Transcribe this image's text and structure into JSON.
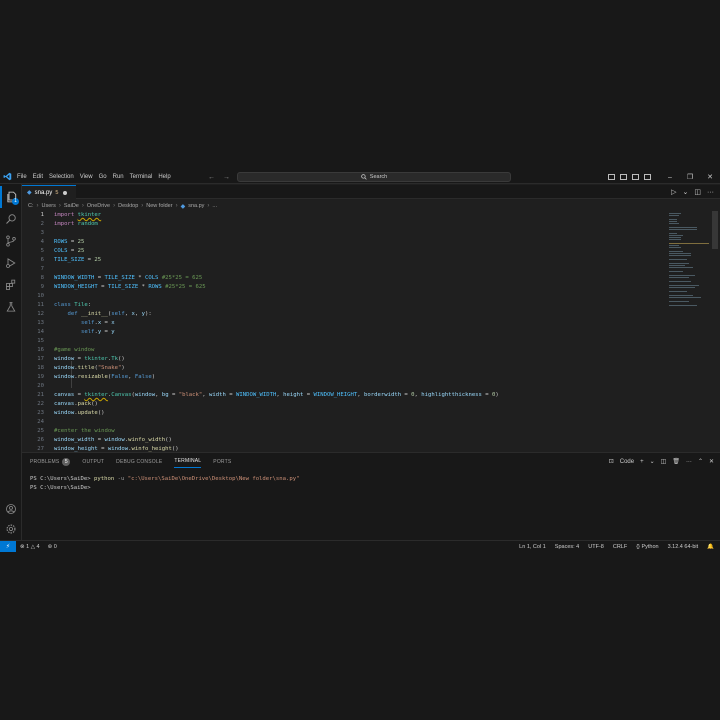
{
  "titlebar": {
    "menu": [
      "File",
      "Edit",
      "Selection",
      "View",
      "Go",
      "Run",
      "Terminal",
      "Help"
    ],
    "search_label": "Search",
    "window_controls": [
      "–",
      "❐",
      "✕"
    ]
  },
  "activity_bar": {
    "explorer_badge": "1"
  },
  "editor": {
    "tab": {
      "filename": "sna.py",
      "modified": "5",
      "icon": "python-file-icon"
    },
    "breadcrumbs": [
      "C:",
      "Users",
      "SaiDe",
      "OneDrive",
      "Desktop",
      "New folder",
      "sna.py",
      "..."
    ],
    "lines": [
      {
        "n": "1",
        "text": "import tkinter"
      },
      {
        "n": "2",
        "text": "import random"
      },
      {
        "n": "3",
        "text": ""
      },
      {
        "n": "4",
        "text": "ROWS = 25"
      },
      {
        "n": "5",
        "text": "COLS = 25"
      },
      {
        "n": "6",
        "text": "TILE_SIZE = 25"
      },
      {
        "n": "7",
        "text": ""
      },
      {
        "n": "8",
        "text": "WINDOW_WIDTH = TILE_SIZE * COLS #25*25 = 625"
      },
      {
        "n": "9",
        "text": "WINDOW_HEIGHT = TILE_SIZE * ROWS #25*25 = 625"
      },
      {
        "n": "10",
        "text": ""
      },
      {
        "n": "11",
        "text": "class Tile:"
      },
      {
        "n": "12",
        "text": "    def __init__(self, x, y):"
      },
      {
        "n": "13",
        "text": "        self.x = x"
      },
      {
        "n": "14",
        "text": "        self.y = y"
      },
      {
        "n": "15",
        "text": ""
      },
      {
        "n": "16",
        "text": "#game window"
      },
      {
        "n": "17",
        "text": "window = tkinter.Tk()"
      },
      {
        "n": "18",
        "text": "window.title(\"Snake\")"
      },
      {
        "n": "19",
        "text": "window.resizable(False, False)"
      },
      {
        "n": "20",
        "text": ""
      },
      {
        "n": "21",
        "text": "canvas = tkinter.Canvas(window, bg = \"black\", width = WINDOW_WIDTH, height = WINDOW_HEIGHT, borderwidth = 0, highlightthickness = 0)"
      },
      {
        "n": "22",
        "text": "canvas.pack()"
      },
      {
        "n": "23",
        "text": "window.update()"
      },
      {
        "n": "24",
        "text": ""
      },
      {
        "n": "25",
        "text": "#center the window"
      },
      {
        "n": "26",
        "text": "window_width = window.winfo_width()"
      },
      {
        "n": "27",
        "text": "window_height = window.winfo_height()"
      }
    ]
  },
  "panel": {
    "tabs": [
      "PROBLEMS",
      "OUTPUT",
      "DEBUG CONSOLE",
      "TERMINAL",
      "PORTS"
    ],
    "problems_badge": "5",
    "active_tab": "TERMINAL",
    "terminal_kind": "Code",
    "terminal_lines": {
      "prompt1": "PS C:\\Users\\SaiDe>",
      "command": "python",
      "flag": "-u",
      "path": "\"c:\\Users\\SaiDe\\OneDrive\\Desktop\\New folder\\sna.py\"",
      "prompt2": "PS C:\\Users\\SaiDe>"
    }
  },
  "statusbar": {
    "errors": "1",
    "warnings": "4",
    "ports": "0",
    "position": "Ln 1, Col 1",
    "spaces": "Spaces: 4",
    "encoding": "UTF-8",
    "eol": "CRLF",
    "language": "Python",
    "interpreter": "3.12.4 64-bit"
  },
  "colors": {
    "accent": "#0078d4",
    "editor_bg": "#1f1f1f",
    "chrome_bg": "#181818"
  }
}
